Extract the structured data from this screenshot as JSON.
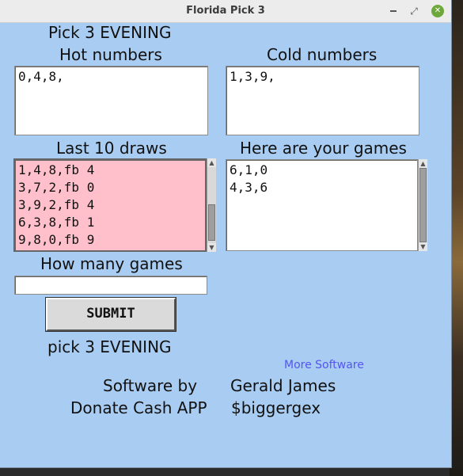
{
  "window": {
    "title": "Florida Pick 3"
  },
  "heading": "Pick 3 EVENING",
  "hot": {
    "label": "Hot numbers",
    "value": "0,4,8,"
  },
  "cold": {
    "label": "Cold numbers",
    "value": "1,3,9,"
  },
  "last_draws": {
    "label": "Last 10 draws",
    "lines": "1,4,8,fb 4\n3,7,2,fb 0\n3,9,2,fb 4\n6,3,8,fb 1\n9,8,0,fb 9"
  },
  "games": {
    "label": "Here are your games",
    "lines": "6,1,0\n4,3,6"
  },
  "how_many": {
    "label": "How many games",
    "value": ""
  },
  "submit_label": "SUBMIT",
  "footer_title": "pick 3 EVENING",
  "more_software": "More Software",
  "credits": {
    "software_by_label": "Software by",
    "author": "Gerald James",
    "donate_label": "Donate Cash APP",
    "cash_tag": "$biggergex"
  }
}
